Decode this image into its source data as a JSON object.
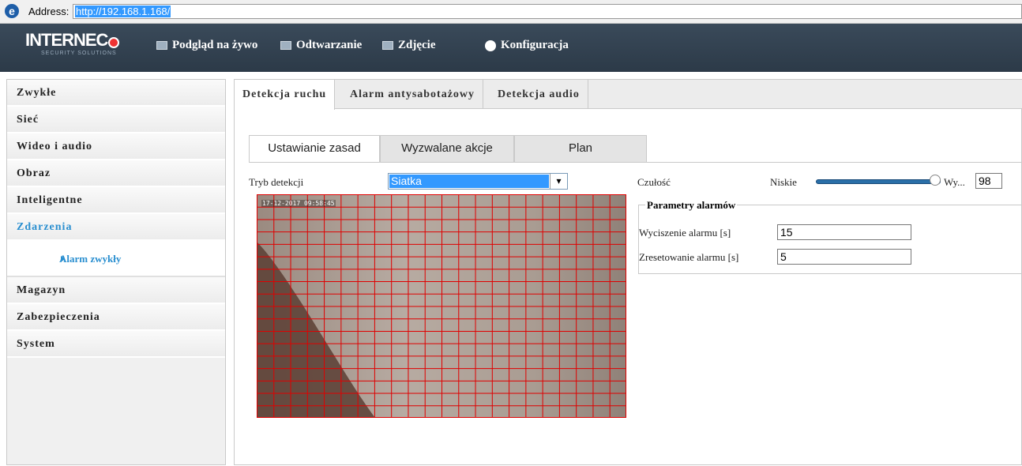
{
  "browser": {
    "address_label": "Address:",
    "url": "http://192.168.1.168/"
  },
  "brand": {
    "name": "INTERNEC",
    "tagline": "SECURITY SOLUTIONS"
  },
  "topnav": {
    "items": [
      {
        "label": "Podgląd na żywo",
        "icon": "monitor-icon"
      },
      {
        "label": "Odtwarzanie",
        "icon": "film-icon"
      },
      {
        "label": "Zdjęcie",
        "icon": "picture-icon"
      },
      {
        "label": "Konfiguracja",
        "icon": "gear-icon",
        "active": true
      }
    ]
  },
  "sidebar": {
    "items": [
      {
        "label": "Zwykłe"
      },
      {
        "label": "Sieć"
      },
      {
        "label": "Wideo i audio"
      },
      {
        "label": "Obraz"
      },
      {
        "label": "Inteligentne"
      },
      {
        "label": "Zdarzenia",
        "active": true
      },
      {
        "label": "Magazyn"
      },
      {
        "label": "Zabezpieczenia"
      },
      {
        "label": "System"
      }
    ],
    "subitem": {
      "label": "Alarm zwykły"
    }
  },
  "main_tabs": [
    "Detekcja ruchu",
    "Alarm antysabotażowy",
    "Detekcja audio"
  ],
  "sub_tabs": [
    "Ustawianie zasad",
    "Wyzwalane akcje",
    "Plan"
  ],
  "detection": {
    "mode_label": "Tryb detekcji",
    "mode_value": "Siatka",
    "video_osd": "17-12-2017  09:58:45"
  },
  "sensitivity": {
    "label": "Czułość",
    "low": "Niskie",
    "high": "Wy...",
    "value": "98",
    "level_percent": 98
  },
  "alarm_params": {
    "title": "Parametry alarmów",
    "silence_label": "Wyciszenie alarmu [s]",
    "silence_value": "15",
    "reset_label": "Zresetowanie alarmu [s]",
    "reset_value": "5"
  },
  "colors": {
    "accent": "#2a9fd8",
    "grid": "#e00000",
    "nav_bg": "#2c3a48"
  }
}
